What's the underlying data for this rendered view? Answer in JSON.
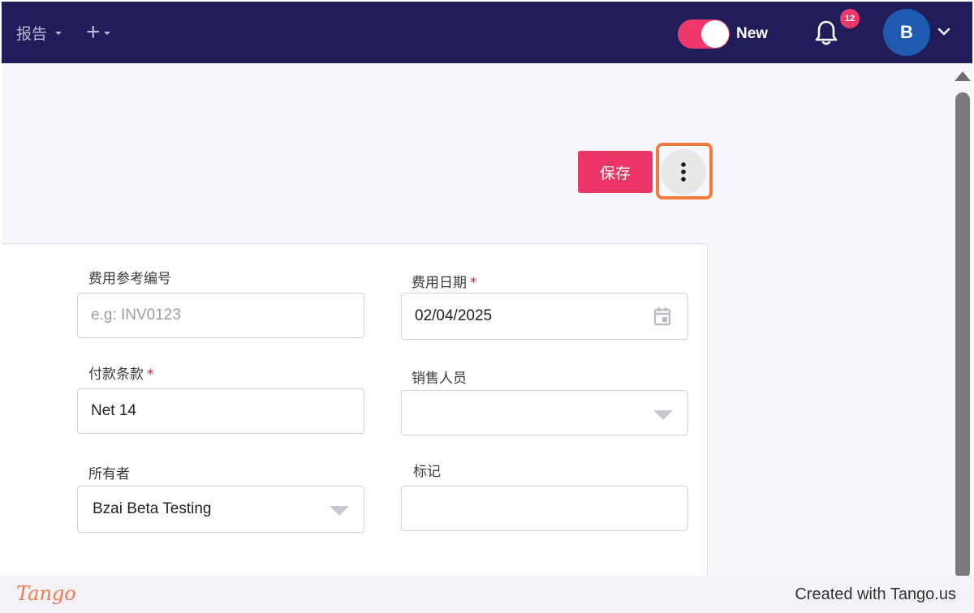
{
  "topbar": {
    "reports_menu": "报告",
    "add_menu": "+",
    "new_toggle_label": "New",
    "notification_count": "12",
    "avatar_initial": "B"
  },
  "toolbar": {
    "save_label": "保存"
  },
  "form": {
    "ref_number": {
      "label": "费用参考编号",
      "placeholder": "e.g: INV0123",
      "value": ""
    },
    "expense_date": {
      "label": "费用日期",
      "required_mark": "*",
      "value": "02/04/2025"
    },
    "payment_terms": {
      "label": "付款条款",
      "required_mark": "*",
      "value": "Net 14"
    },
    "salesperson": {
      "label": "销售人员",
      "value": ""
    },
    "owner": {
      "label": "所有者",
      "value": "Bzai Beta Testing"
    },
    "tags": {
      "label": "标记",
      "value": ""
    }
  },
  "footer": {
    "logo_text": "Tango",
    "created_with": "Created with Tango.us"
  },
  "colors": {
    "topbar": "#201d5a",
    "accent": "#ec3668",
    "highlight": "#f47a3c",
    "avatar": "#1e5bb1"
  },
  "icons": [
    "chevron-down-icon",
    "plus-icon",
    "bell-icon",
    "more-vertical-icon",
    "calendar-icon",
    "scroll-up-icon"
  ]
}
